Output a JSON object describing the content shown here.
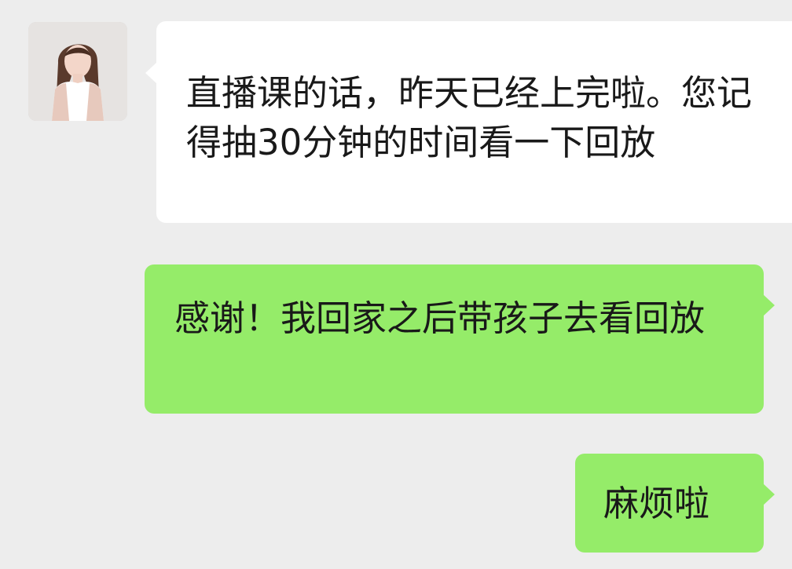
{
  "chat": {
    "messages": [
      {
        "sender": "contact",
        "text": "直播课的话，昨天已经上完啦。您记得抽30分钟的时间看一下回放"
      },
      {
        "sender": "me",
        "text": "感谢！我回家之后带孩子去看回放"
      },
      {
        "sender": "me",
        "text": "麻烦啦"
      }
    ]
  },
  "colors": {
    "background": "#ededed",
    "incoming_bubble": "#ffffff",
    "outgoing_bubble": "#95ec69",
    "text": "#191919"
  },
  "icons": {
    "contact_avatar": "contact-avatar-photo"
  }
}
